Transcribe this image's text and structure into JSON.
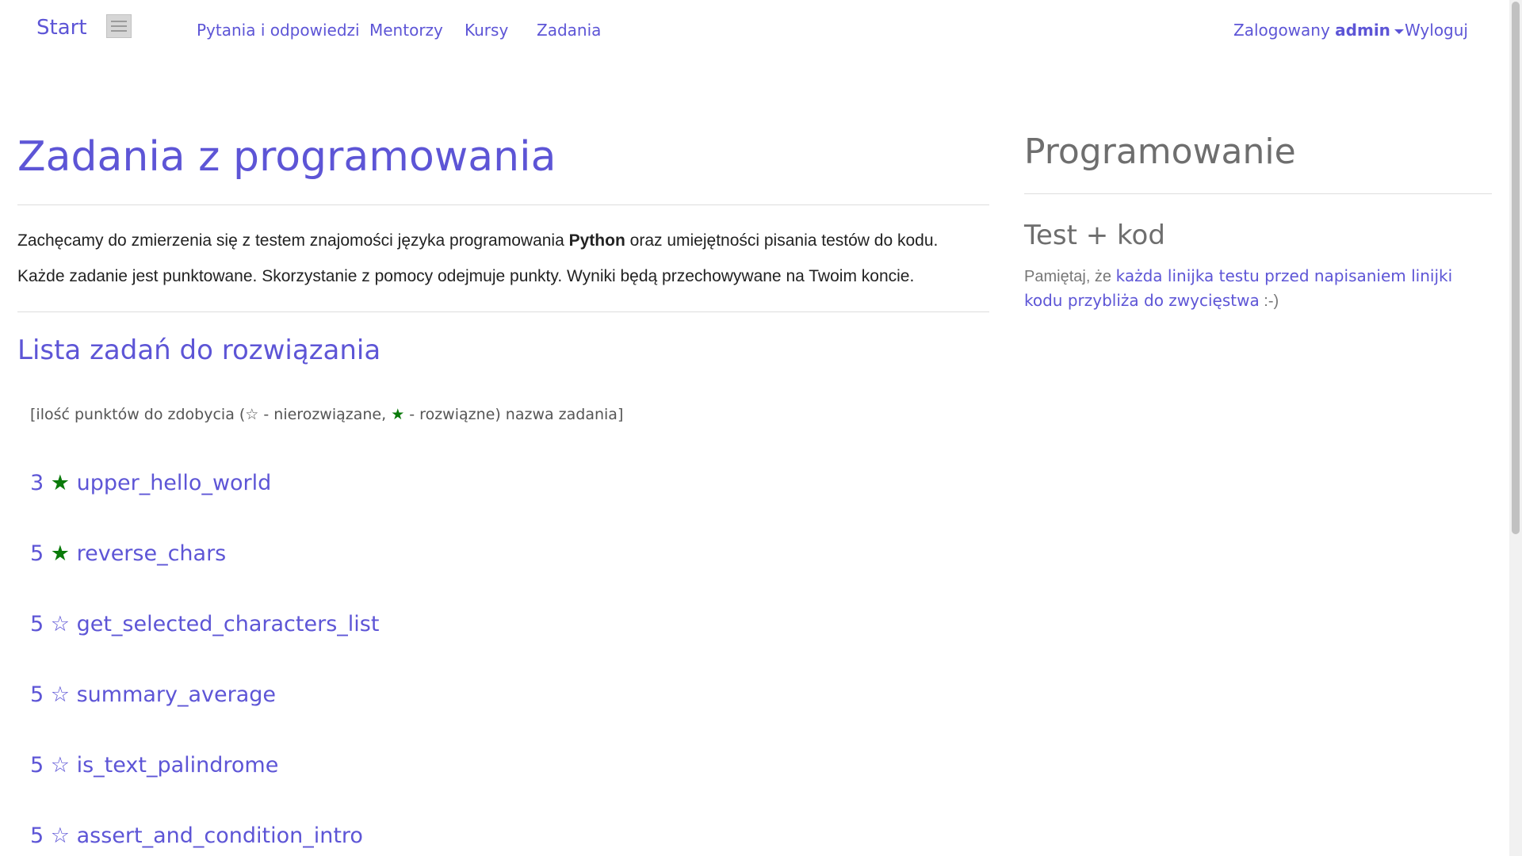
{
  "nav": {
    "brand": "Start",
    "items": [
      "Pytania i odpowiedzi",
      "Mentorzy",
      "Kursy",
      "Zadania"
    ],
    "logged_prefix": "Zalogowany",
    "username": "admin",
    "logout": "Wyloguj"
  },
  "main": {
    "title": "Zadania z programowania",
    "intro": {
      "p1_before": "Zachęcamy do zmierzenia się z testem znajomości języka programowania",
      "p1_bold": "Python",
      "p1_after": "oraz umiejętności pisania testów do kodu.",
      "p2": "Każde zadanie jest punktowane. Skorzystanie z pomocy odejmuje punkty. Wyniki będą przechowywane na Twoim koncie."
    },
    "list_title": "Lista zadań do rozwiązania",
    "legend": {
      "open_star": "☆",
      "solved_star": "★",
      "part1": "[ilość punktów do zdobycia (",
      "part2": "- nierozwiązane,",
      "part3": "- rozwiązne) nazwa zadania]"
    },
    "tasks": [
      {
        "points": "3",
        "star": "★",
        "name": "upper_hello_world",
        "solved": true
      },
      {
        "points": "5",
        "star": "★",
        "name": "reverse_chars",
        "solved": true
      },
      {
        "points": "5",
        "star": "☆",
        "name": "get_selected_characters_list",
        "solved": false
      },
      {
        "points": "5",
        "star": "☆",
        "name": "summary_average",
        "solved": false
      },
      {
        "points": "5",
        "star": "☆",
        "name": "is_text_palindrome",
        "solved": false
      },
      {
        "points": "5",
        "star": "☆",
        "name": "assert_and_condition_intro",
        "solved": false
      }
    ]
  },
  "sidebar": {
    "title": "Programowanie",
    "subtitle": "Test + kod",
    "text_before": "Pamiętaj, że",
    "text_link": "każda linijka testu przed napisaniem linijki kodu przybliża do zwycięstwa",
    "text_after": ":-)"
  },
  "colors": {
    "accent": "#5d55d6",
    "solved_star": "#0a7a0a"
  },
  "icons": {
    "menu": "hamburger-menu-icon",
    "dropdown": "caret-down-icon"
  }
}
